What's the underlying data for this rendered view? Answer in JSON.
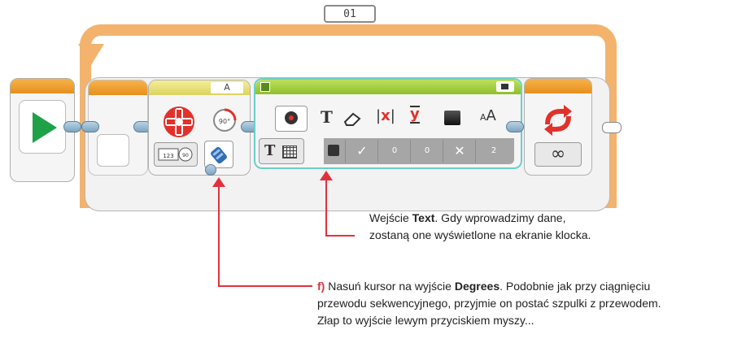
{
  "loop": {
    "counter": "01",
    "port_label": "A"
  },
  "motor": {
    "port": "A"
  },
  "display_params": [
    "0",
    "0",
    "2"
  ],
  "display_icons": [
    "T",
    "eraser-icon",
    "|x|",
    "y",
    "square",
    "AA"
  ],
  "annotations": {
    "text_note": {
      "line1_prefix": "Wejście ",
      "line1_bold": "Text",
      "line1_suffix": ". Gdy wprowadzimy dane,",
      "line2": "zostaną one wyświetlone na ekranie klocka."
    },
    "degrees_note": {
      "marker": "f)",
      "line1_prefix": " Nasuń kursor na wyjście ",
      "line1_bold": "Degrees",
      "line1_suffix": ". Podobnie jak przy ciągnięciu",
      "line2": "przewodu sekwencyjnego, przyjmie on postać szpulki z przewodem.",
      "line3": "Złap to wyjście lewym przyciskiem myszy..."
    }
  },
  "colors": {
    "loop": "#f3b36d",
    "play": "#1fa247",
    "accent_red": "#e0323c",
    "display_border": "#6ad0c8"
  }
}
